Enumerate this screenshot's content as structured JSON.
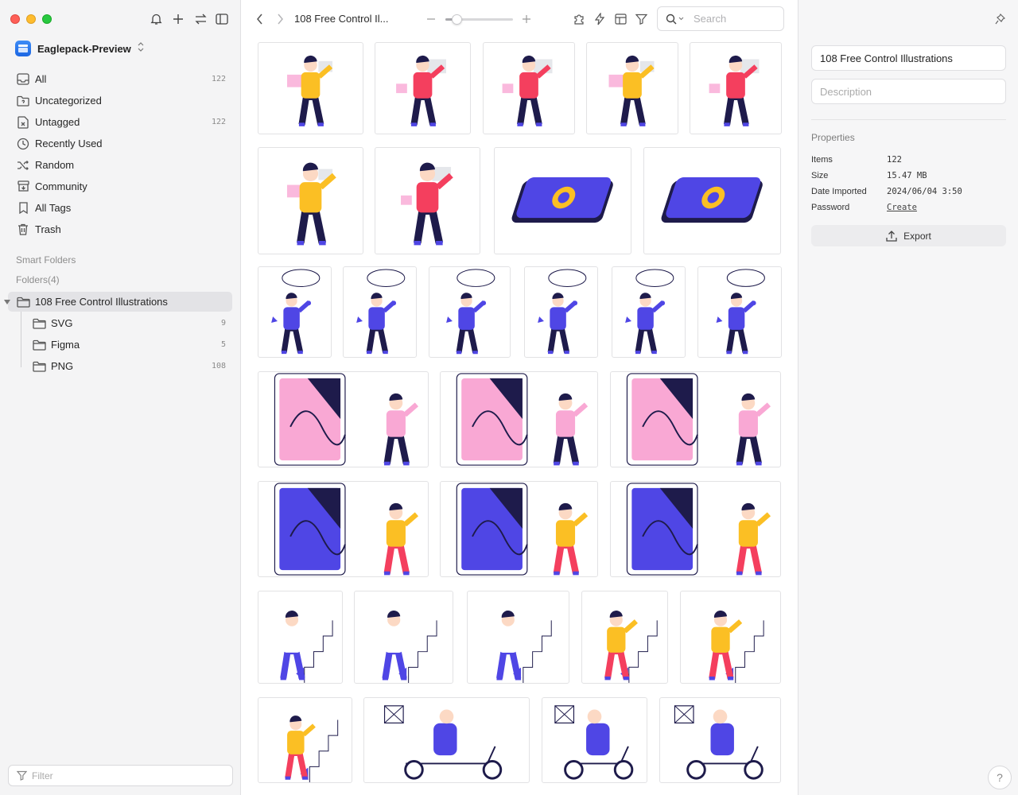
{
  "sidebar": {
    "library_name": "Eaglepack-Preview",
    "nav": [
      {
        "label": "All",
        "count": "122",
        "icon": "inbox-icon"
      },
      {
        "label": "Uncategorized",
        "count": "",
        "icon": "folder-question-icon"
      },
      {
        "label": "Untagged",
        "count": "122",
        "icon": "tag-off-icon"
      },
      {
        "label": "Recently Used",
        "count": "",
        "icon": "clock-icon"
      },
      {
        "label": "Random",
        "count": "",
        "icon": "shuffle-icon"
      },
      {
        "label": "Community",
        "count": "",
        "icon": "archive-icon"
      },
      {
        "label": "All Tags",
        "count": "",
        "icon": "bookmark-icon"
      },
      {
        "label": "Trash",
        "count": "",
        "icon": "trash-icon"
      }
    ],
    "smart_folders_label": "Smart Folders",
    "folders_label": "Folders(4)",
    "folders": [
      {
        "label": "108 Free Control Illustrations",
        "count": "",
        "selected": true
      },
      {
        "label": "SVG",
        "count": "9"
      },
      {
        "label": "Figma",
        "count": "5"
      },
      {
        "label": "PNG",
        "count": "108"
      }
    ],
    "filter_placeholder": "Filter"
  },
  "toolbar": {
    "breadcrumb": "108 Free Control Il...",
    "zoom_level": 0.1,
    "search_placeholder": "Search"
  },
  "inspector": {
    "title_value": "108 Free Control Illustrations",
    "description_placeholder": "Description",
    "properties_label": "Properties",
    "properties": [
      {
        "key": "Items",
        "value": "122",
        "link": false
      },
      {
        "key": "Size",
        "value": "15.47 MB",
        "link": false
      },
      {
        "key": "Date Imported",
        "value": "2024/06/04 3:50",
        "link": false
      },
      {
        "key": "Password",
        "value": "Create",
        "link": true
      }
    ],
    "export_label": "Export"
  },
  "colors": {
    "accent_blue": "#4f46e5",
    "navy": "#1e1b4b",
    "yellow": "#fbbf24",
    "red": "#f43f5e",
    "pink": "#f9a8d4",
    "skin": "#fcd9c4"
  }
}
